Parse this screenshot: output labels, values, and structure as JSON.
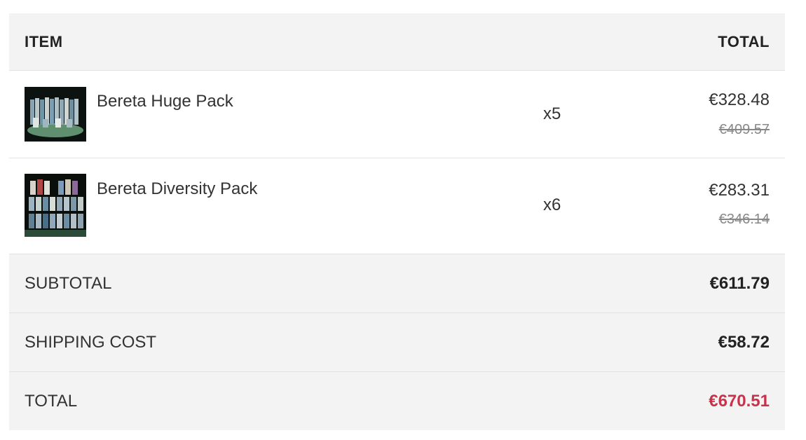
{
  "table": {
    "header": {
      "item_label": "ITEM",
      "total_label": "TOTAL"
    },
    "items": [
      {
        "name": "Bereta Huge Pack",
        "quantity": "x5",
        "price": "€328.48",
        "old_price": "€409.57"
      },
      {
        "name": "Bereta Diversity Pack",
        "quantity": "x6",
        "price": "€283.31",
        "old_price": "€346.14"
      }
    ],
    "summary": {
      "subtotal_label": "SUBTOTAL",
      "subtotal_value": "€611.79",
      "shipping_label": "SHIPPING COST",
      "shipping_value": "€58.72",
      "total_label": "TOTAL",
      "total_value": "€670.51"
    }
  },
  "colors": {
    "header_bg": "#f3f3f3",
    "grand_total": "#c8324a",
    "strikethrough": "#888888"
  }
}
